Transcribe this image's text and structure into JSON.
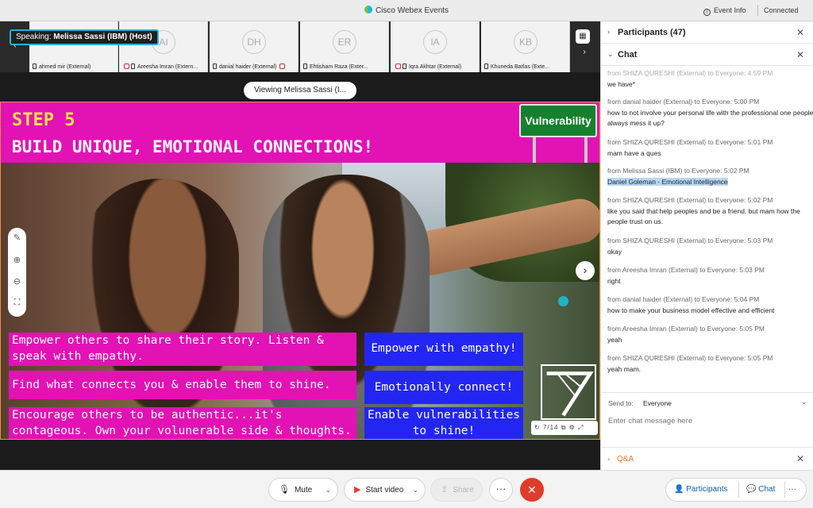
{
  "window": {
    "title": "Cisco Webex Events",
    "event_info": "Event Info",
    "status": "Connected"
  },
  "strip": {
    "speaking_label": "Speaking:",
    "speaking_name": "Melissa Sassi (IBM) (Host)",
    "thumbs": [
      {
        "initials": "",
        "name": "ahmed mir (External)"
      },
      {
        "initials": "AI",
        "name": "Areesha Imran (Extern..."
      },
      {
        "initials": "DH",
        "name": "danial haider (External)"
      },
      {
        "initials": "ER",
        "name": "Ehtisham Raza (Exter..."
      },
      {
        "initials": "IA",
        "name": "Iqra Akhtar (External)"
      },
      {
        "initials": "KB",
        "name": "Khuneda Barlas (Exte..."
      }
    ]
  },
  "viewing": "Viewing Melissa Sassi (I...",
  "slide": {
    "step": "STEP 5",
    "headline": "BUILD UNIQUE, EMOTIONAL CONNECTIONS!",
    "sign": "Vulnerability",
    "captions_left": [
      "Empower others to share their story. Listen & speak with empathy.",
      "Find what connects you & enable them to shine.",
      "Encourage others to be authentic...it's contageous. Own your volunerable side & thoughts."
    ],
    "captions_right": [
      "Empower with empathy!",
      "Emotionally connect!",
      "Enable vulnerabilities to shine!"
    ],
    "page_indicator": "7/14"
  },
  "panel": {
    "participants_label": "Participants (47)",
    "chat_label": "Chat",
    "messages": [
      {
        "from": "",
        "body": "we have*"
      },
      {
        "from": "from danial haider (External) to Everyone:    5:00  PM",
        "body": "how to not involve your personal life with the professional one people always mess it up?"
      },
      {
        "from": "from SHIZA QURESHI (External) to Everyone:    5:01  PM",
        "body": "mam  have a ques"
      },
      {
        "from": "from Melissa Sassi (IBM) to Everyone:    5:02  PM",
        "body": "Daniel Goleman - Emotional Intelligence"
      },
      {
        "from": "from SHIZA QURESHI (External) to Everyone:    5:02  PM",
        "body": "like you said that help peoples and be a friend. but mam how the people trust on us."
      },
      {
        "from": "from SHIZA QURESHI (External) to Everyone:    5:03  PM",
        "body": "okay"
      },
      {
        "from": "from Areesha Imran (External) to Everyone:    5:03  PM",
        "body": "right"
      },
      {
        "from": "from danial haider (External) to Everyone:    5:04  PM",
        "body": "how to make your business model effective and efficient"
      },
      {
        "from": "from Areesha Imran (External) to Everyone:    5:05  PM",
        "body": "yeah"
      },
      {
        "from": "from SHIZA QURESHI (External) to Everyone:    5:05  PM",
        "body": "yeah mam."
      }
    ],
    "send_to_label": "Send to:",
    "send_to_value": "Everyone",
    "chat_placeholder": "Enter chat message here",
    "qa_label": "Q&A"
  },
  "controls": {
    "mute": "Mute",
    "start_video": "Start video",
    "share": "Share",
    "more": "···",
    "end": "✕",
    "participants": "Participants",
    "chat": "Chat",
    "overflow": "···"
  },
  "colors": {
    "slide_pink": "#e212b5",
    "slide_blue": "#2326f2",
    "step_yellow": "#f6e04d",
    "end_red": "#e03c2b",
    "link_blue": "#0a5fb4"
  }
}
